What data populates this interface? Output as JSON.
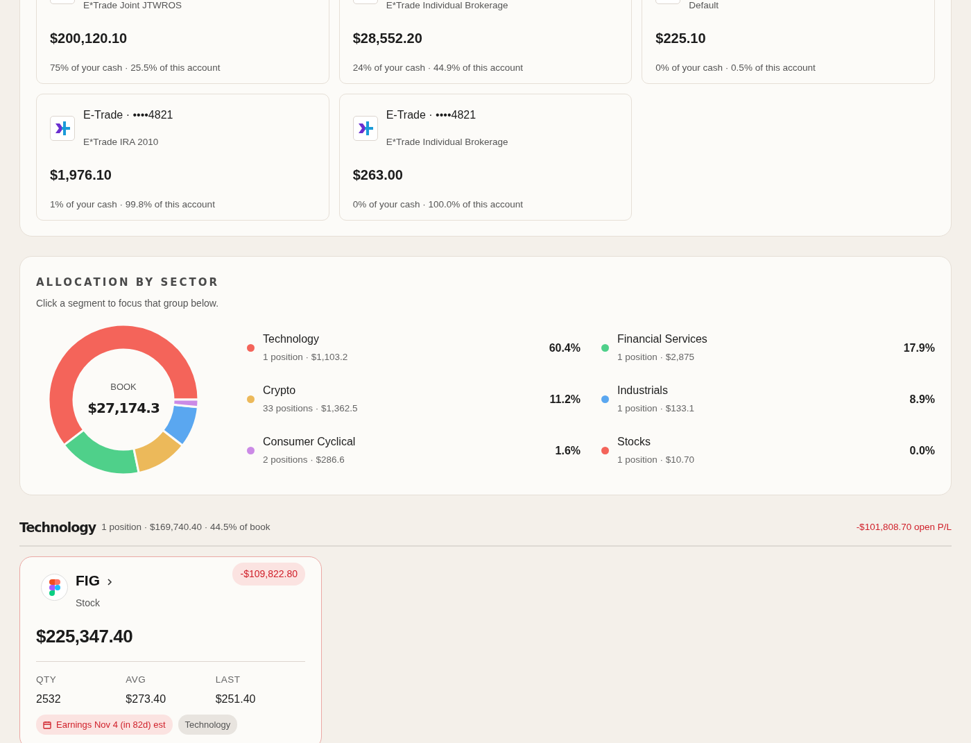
{
  "accounts": [
    {
      "subtitle": "E*Trade Joint JTWROS",
      "amount": "$200,120.10",
      "summary": "75% of your cash · 25.5% of this account"
    },
    {
      "subtitle": "E*Trade Individual Brokerage",
      "amount": "$28,552.20",
      "summary": "24% of your cash · 44.9% of this account"
    },
    {
      "subtitle": "Default",
      "amount": "$225.10",
      "summary": "0% of your cash · 0.5% of this account"
    },
    {
      "title": "E-Trade · ••••4821",
      "subtitle": "E*Trade IRA 2010",
      "amount": "$1,976.10",
      "summary": "1% of your cash · 99.8% of this account"
    },
    {
      "title": "E-Trade · ••••4821",
      "subtitle": "E*Trade Individual Brokerage",
      "amount": "$263.00",
      "summary": "0% of your cash · 100.0% of this account"
    }
  ],
  "allocation": {
    "title": "ALLOCATION BY SECTOR",
    "hint": "Click a segment to focus that group below.",
    "center_label": "BOOK",
    "center_value": "$27,174.3",
    "chart_data": {
      "type": "donut",
      "categories": [
        "Technology",
        "Financial Services",
        "Crypto",
        "Industrials",
        "Consumer Cyclical",
        "Stocks"
      ],
      "values": [
        60.4,
        17.9,
        11.2,
        8.9,
        1.6,
        0.0
      ]
    },
    "sectors": [
      {
        "detail": "1 position · $1,103.2",
        "percent": "60.4%",
        "color": "#f4645a"
      },
      {
        "detail": "1 position · $2,875",
        "percent": "17.9%",
        "color": "#4fd08a"
      },
      {
        "detail": "33 positions · $1,362.5",
        "percent": "11.2%",
        "color": "#ecb95a"
      },
      {
        "detail": "1 position · $133.1",
        "percent": "8.9%",
        "color": "#5aa7f0"
      },
      {
        "detail": "2 positions · $286.6",
        "percent": "1.6%",
        "color": "#cb8ae6"
      },
      {
        "detail": "1 position · $10.70",
        "percent": "0.0%",
        "color": "#f4645a"
      }
    ]
  },
  "group": {
    "title": "Technology",
    "summary": "1 position · $169,740.40 · 44.5% of book",
    "pl": "-$101,808.70 open P/L"
  },
  "positions": [
    {
      "ticker": "FIG",
      "type": "Stock",
      "pl": "-$109,822.80",
      "value": "$225,347.40",
      "stats": [
        {
          "label": "QTY",
          "value": "2532"
        },
        {
          "label": "AVG",
          "value": "$273.40"
        },
        {
          "label": "LAST",
          "value": "$251.40"
        }
      ],
      "tags": [
        {
          "kind": "earnings",
          "text": "Earnings Nov 4 (in 82d) est"
        },
        {
          "kind": "sector",
          "text": "Technology"
        }
      ]
    }
  ]
}
